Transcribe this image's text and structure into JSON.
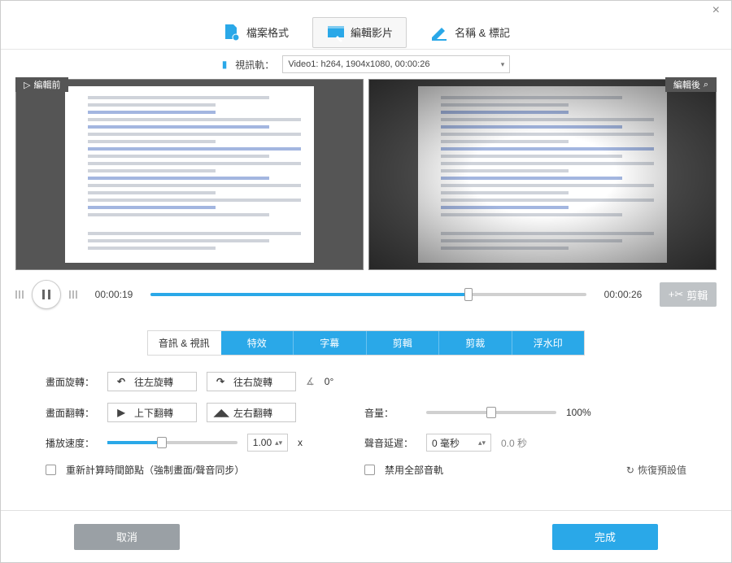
{
  "topnav": {
    "format": "檔案格式",
    "edit": "編輯影片",
    "name": "名稱 & 標記"
  },
  "track": {
    "label": "視訊軌：",
    "value": "Video1: h264, 1904x1080, 00:00:26"
  },
  "preview": {
    "before": "編輯前",
    "after": "編輯後"
  },
  "timeline": {
    "current": "00:00:19",
    "total": "00:00:26",
    "trim_label": "剪輯",
    "progress_pct": 73
  },
  "tabs": {
    "av": "音訊 & 視訊",
    "effect": "特效",
    "subtitle": "字幕",
    "trim": "剪輯",
    "crop": "剪裁",
    "watermark": "浮水印"
  },
  "settings": {
    "rotate_label": "畫面旋轉：",
    "rotate_left": "往左旋轉",
    "rotate_right": "往右旋轉",
    "angle": "0°",
    "flip_label": "畫面翻轉：",
    "flip_v": "上下翻轉",
    "flip_h": "左右翻轉",
    "speed_label": "播放速度：",
    "speed_value": "1.00",
    "speed_unit": "x",
    "speed_pct": 42,
    "volume_label": "音量：",
    "volume_value": "100%",
    "volume_pct": 50,
    "delay_label": "聲音延遲：",
    "delay_sel": "0 毫秒",
    "delay_hint": "0.0 秒",
    "recalc": "重新計算時間節點（強制畫面/聲音同步）",
    "disable_tracks": "禁用全部音軌",
    "restore": "恢復預設值"
  },
  "footer": {
    "cancel": "取消",
    "ok": "完成"
  }
}
